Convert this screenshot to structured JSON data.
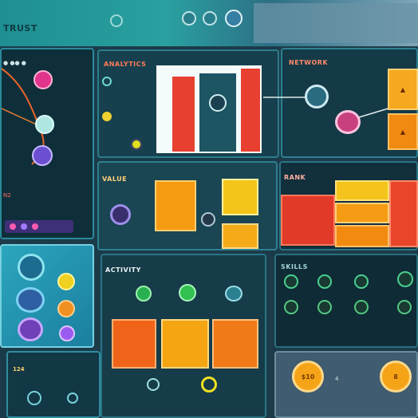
{
  "top": {
    "title": "TRUST"
  },
  "panels": {
    "chart_panel": {
      "label": "ANALYTICS"
    },
    "flow_panel": {
      "label": "NETWORK"
    },
    "mid_panel": {
      "label": "VALUE"
    },
    "rank_panel": {
      "label": "RANK"
    },
    "bottom_panel": {
      "label": "ACTIVITY"
    },
    "grid_panel": {
      "label": "SKILLS"
    }
  },
  "side_counter": "124",
  "badges": [
    "N2",
    "$10",
    "4",
    "8"
  ],
  "colors": {
    "teal": "#1f8c8c",
    "orange": "#f07a1a",
    "amber": "#f2b21c",
    "red": "#e63a2e",
    "dark": "#173440"
  }
}
